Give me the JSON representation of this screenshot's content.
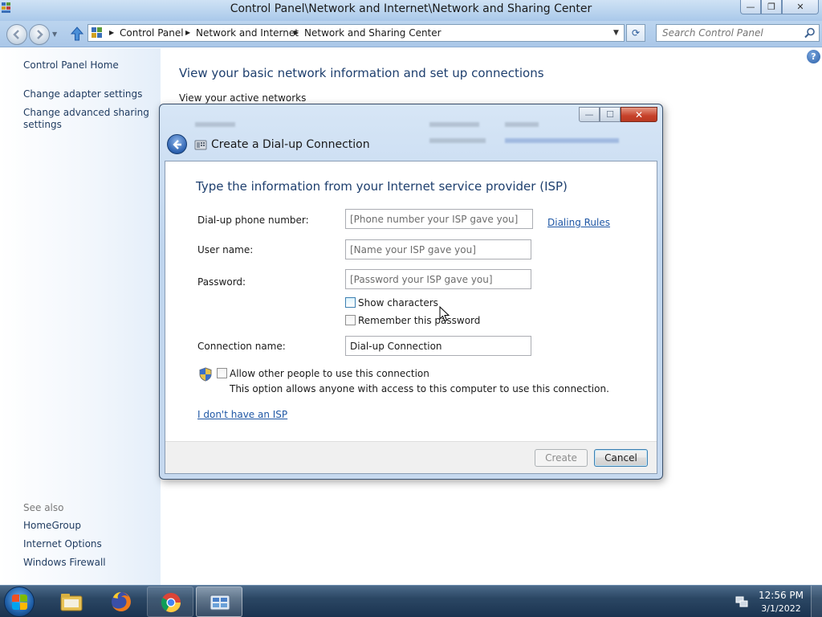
{
  "window": {
    "title": "Control Panel\\Network and Internet\\Network and Sharing Center",
    "minimize_label": "—",
    "maximize_label": "❐",
    "close_label": "✕"
  },
  "address_bar": {
    "breadcrumbs": [
      "Control Panel",
      "Network and Internet",
      "Network and Sharing Center"
    ],
    "search_placeholder": "Search Control Panel"
  },
  "sidebar": {
    "home": "Control Panel Home",
    "links": [
      "Change adapter settings",
      "Change advanced sharing settings"
    ],
    "see_also_label": "See also",
    "see_also": [
      "HomeGroup",
      "Internet Options",
      "Windows Firewall"
    ]
  },
  "main": {
    "title": "View your basic network information and set up connections",
    "active_networks_label": "View your active networks"
  },
  "dialog": {
    "title": "Create a Dial-up Connection",
    "instruction": "Type the information from your Internet service provider (ISP)",
    "phone_label": "Dial-up phone number:",
    "phone_placeholder": "[Phone number your ISP gave you]",
    "dialing_rules_link": "Dialing Rules",
    "username_label": "User name:",
    "username_placeholder": "[Name your ISP gave you]",
    "password_label": "Password:",
    "password_placeholder": "[Password your ISP gave you]",
    "show_characters_label": "Show characters",
    "remember_password_label": "Remember this password",
    "connection_name_label": "Connection name:",
    "connection_name_value": "Dial-up Connection",
    "allow_others_label": "Allow other people to use this connection",
    "allow_others_desc": "This option allows anyone with access to this computer to use this connection.",
    "no_isp_link": "I don't have an ISP",
    "create_button": "Create",
    "cancel_button": "Cancel"
  },
  "taskbar": {
    "items": [
      "windows-explorer",
      "firefox",
      "chrome",
      "control-panel"
    ],
    "clock_time": "12:56 PM",
    "clock_date": "3/1/2022"
  }
}
